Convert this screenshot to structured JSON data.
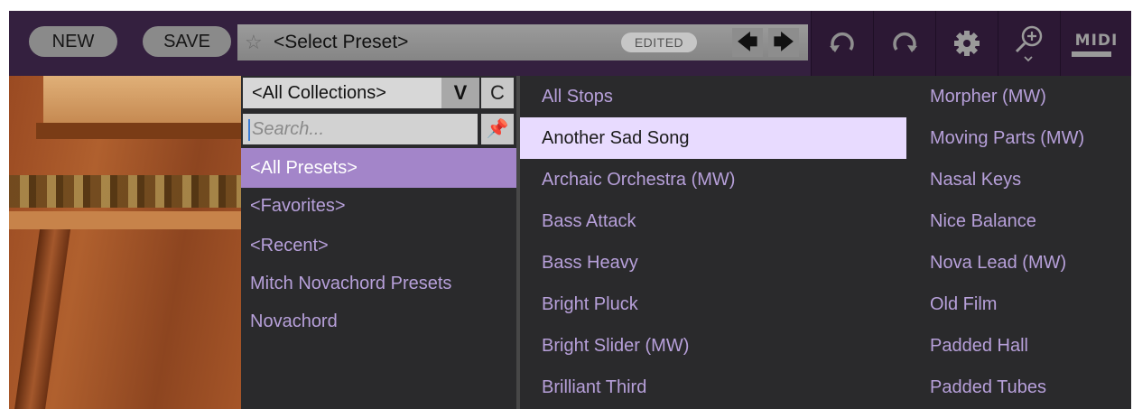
{
  "toolbar": {
    "new_label": "NEW",
    "save_label": "SAVE",
    "preset_name": "<Select Preset>",
    "edited_badge": "EDITED",
    "prev_arrow": "🡄",
    "next_arrow": "🡆",
    "midi_label": "MIDI",
    "icons": [
      "star-icon",
      "arrow-left-icon",
      "arrow-right-icon",
      "undo-icon",
      "redo-icon",
      "gear-icon",
      "zoom-icon",
      "midi-icon"
    ]
  },
  "collections": {
    "selected": "<All Collections>",
    "chevron": "V",
    "refresh": "C",
    "search_placeholder": "Search...",
    "pin": "📌",
    "items": [
      {
        "label": "<All Presets>",
        "active": true
      },
      {
        "label": "<Favorites>",
        "active": false
      },
      {
        "label": "<Recent>",
        "active": false
      },
      {
        "label": "Mitch Novachord Presets",
        "active": false
      },
      {
        "label": "Novachord",
        "active": false
      }
    ]
  },
  "presets": {
    "col1": [
      "All Stops",
      "Another Sad Song",
      "Archaic Orchestra (MW)",
      "Bass Attack",
      "Bass Heavy",
      "Bright Pluck",
      "Bright Slider (MW)",
      "Brilliant Third"
    ],
    "col2": [
      "Morpher (MW)",
      "Moving Parts (MW)",
      "Nasal Keys",
      "Nice Balance",
      "Nova Lead (MW)",
      "Old Film",
      "Padded Hall",
      "Padded Tubes"
    ],
    "highlighted": "Another Sad Song"
  },
  "colors": {
    "toolbar_bg": "#34203f",
    "accent_purple": "#a385c9",
    "list_text": "#b7a0da",
    "highlight": "#e8dbff"
  }
}
